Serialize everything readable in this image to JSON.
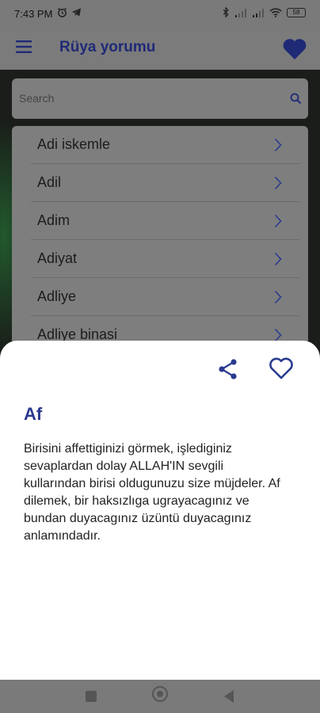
{
  "status_bar": {
    "time": "7:43 PM",
    "battery": "58",
    "left_icons": [
      "alarm-icon",
      "telegram-icon"
    ],
    "right_icons": [
      "bluetooth-icon",
      "signal-icon",
      "signal-icon",
      "wifi-icon",
      "battery-icon"
    ]
  },
  "app_bar": {
    "title": "Rüya yorumu",
    "accent_color": "#1f2a77"
  },
  "search": {
    "placeholder": "Search",
    "value": ""
  },
  "list": {
    "items": [
      {
        "label": "Adi iskemle"
      },
      {
        "label": "Adil"
      },
      {
        "label": "Adim"
      },
      {
        "label": "Adiyat"
      },
      {
        "label": "Adliye"
      },
      {
        "label": "Adliye binasi"
      }
    ]
  },
  "sheet": {
    "title": "Af",
    "body": "Birisini affettiginizi görmek, işlediginiz sevaplardan dolay ALLAH'IN sevgili kullarından birisi oldugunuzu size müjdeler. Af dilemek, bir haksızlıga ugrayacagınız ve bundan duyacagınız üzüntü duyacagınız anlamındadır.",
    "title_color": "#2a3a8f"
  }
}
